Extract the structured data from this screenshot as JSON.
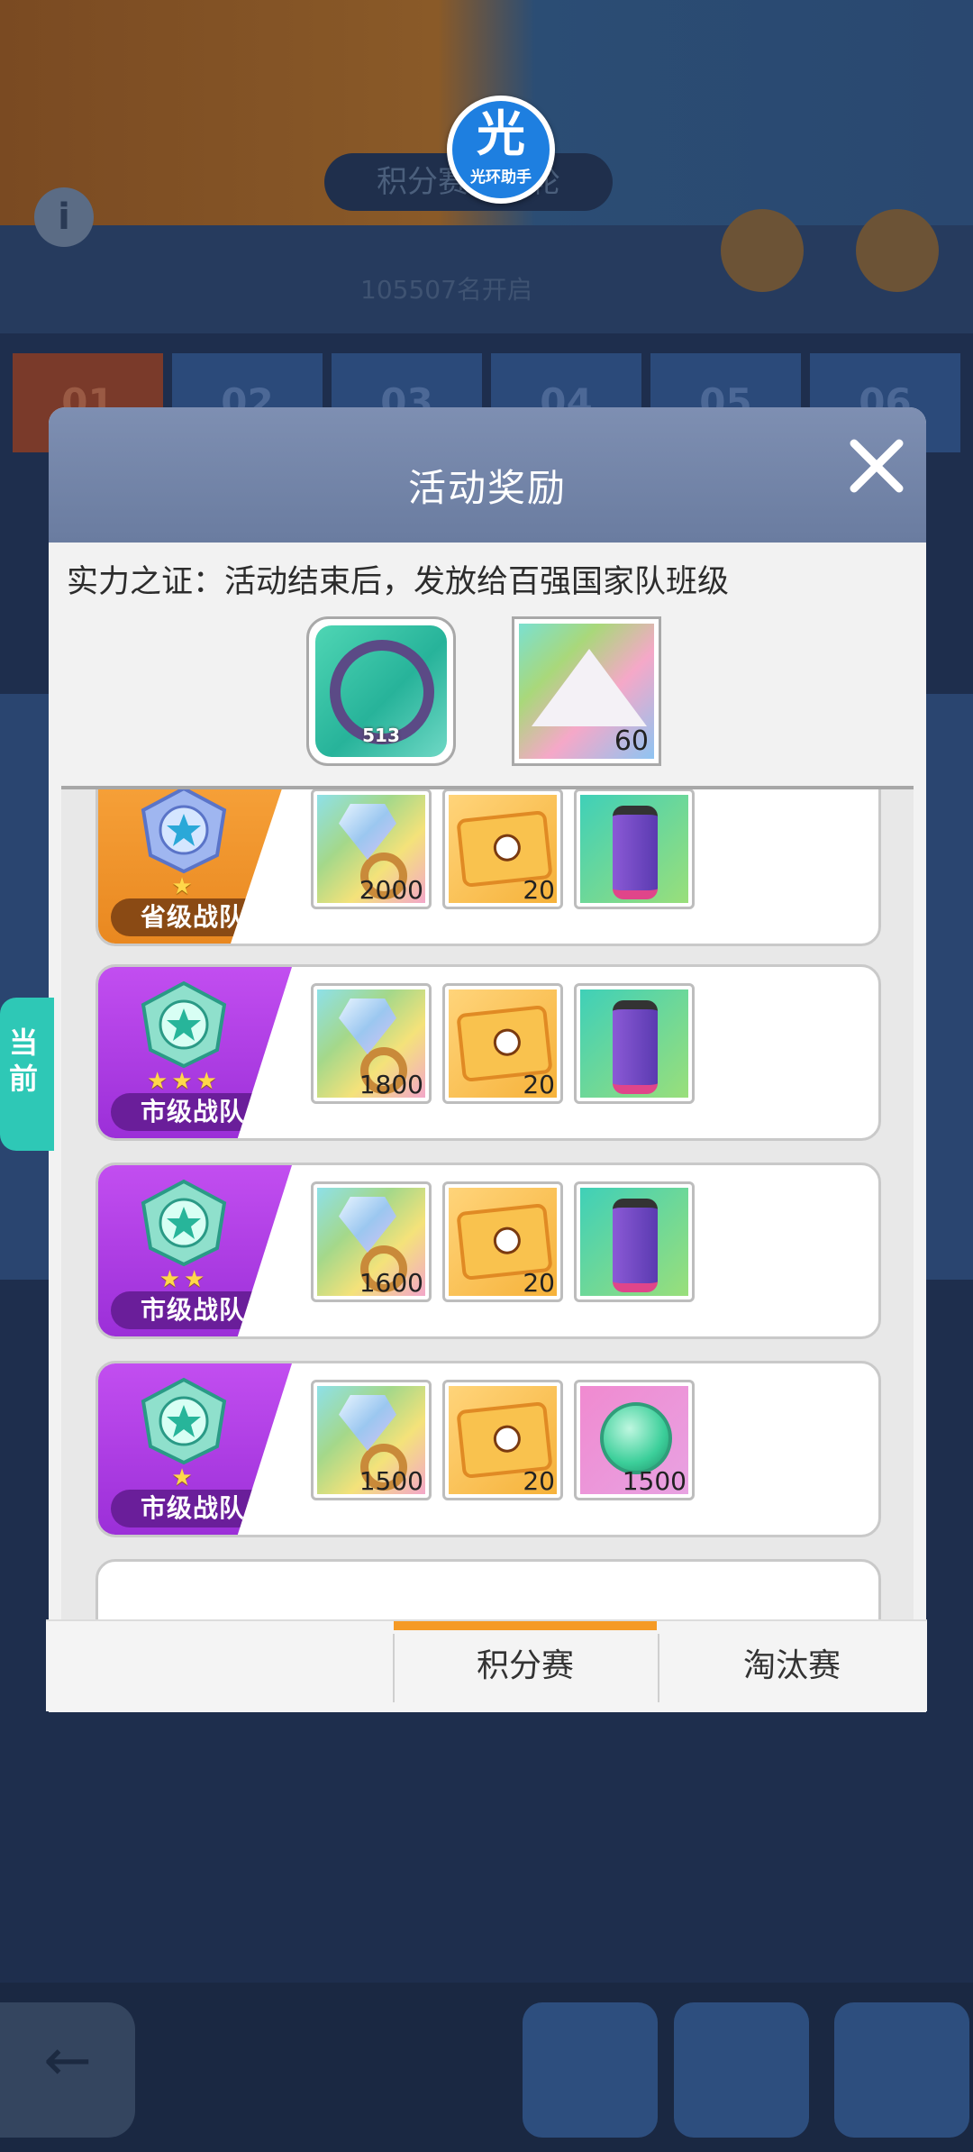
{
  "watermark": {
    "main": "光",
    "sub": "光环助手"
  },
  "background": {
    "title": "积分赛第二轮",
    "subtitle": "105507名开启",
    "tabs": [
      "01",
      "02",
      "03",
      "04",
      "05",
      "06"
    ]
  },
  "modal": {
    "title": "活动奖励",
    "intro": "实力之证：活动结束后，发放给百强国家队班级",
    "top_rewards": [
      {
        "icon": "avatar-frame-icon",
        "badge": "513"
      },
      {
        "icon": "crystal-powder-icon",
        "count": "60"
      }
    ],
    "current_marker": "当前",
    "tiers": [
      {
        "label": "省级战队",
        "stars": "★",
        "items": [
          {
            "icon": "gem-ring-icon",
            "count": "2000"
          },
          {
            "icon": "ticket-icon",
            "count": "20"
          },
          {
            "icon": "gene-capsule-icon",
            "count": ""
          }
        ]
      },
      {
        "label": "市级战队",
        "stars": "★★★",
        "items": [
          {
            "icon": "gem-ring-icon",
            "count": "1800"
          },
          {
            "icon": "ticket-icon",
            "count": "20"
          },
          {
            "icon": "gene-capsule-icon",
            "count": ""
          }
        ]
      },
      {
        "label": "市级战队",
        "stars": "★★",
        "items": [
          {
            "icon": "gem-ring-icon",
            "count": "1600"
          },
          {
            "icon": "ticket-icon",
            "count": "20"
          },
          {
            "icon": "gene-capsule-icon",
            "count": ""
          }
        ]
      },
      {
        "label": "市级战队",
        "stars": "★",
        "items": [
          {
            "icon": "gem-ring-icon",
            "count": "1500"
          },
          {
            "icon": "ticket-icon",
            "count": "20"
          },
          {
            "icon": "energy-orb-icon",
            "count": "1500"
          }
        ]
      }
    ],
    "footer_tabs": [
      {
        "label": "积分赛",
        "active": true
      },
      {
        "label": "淘汰赛",
        "active": false
      }
    ]
  },
  "colors": {
    "accent": "#f59a25",
    "current": "#2ec8b6",
    "header": "#7386aa"
  }
}
